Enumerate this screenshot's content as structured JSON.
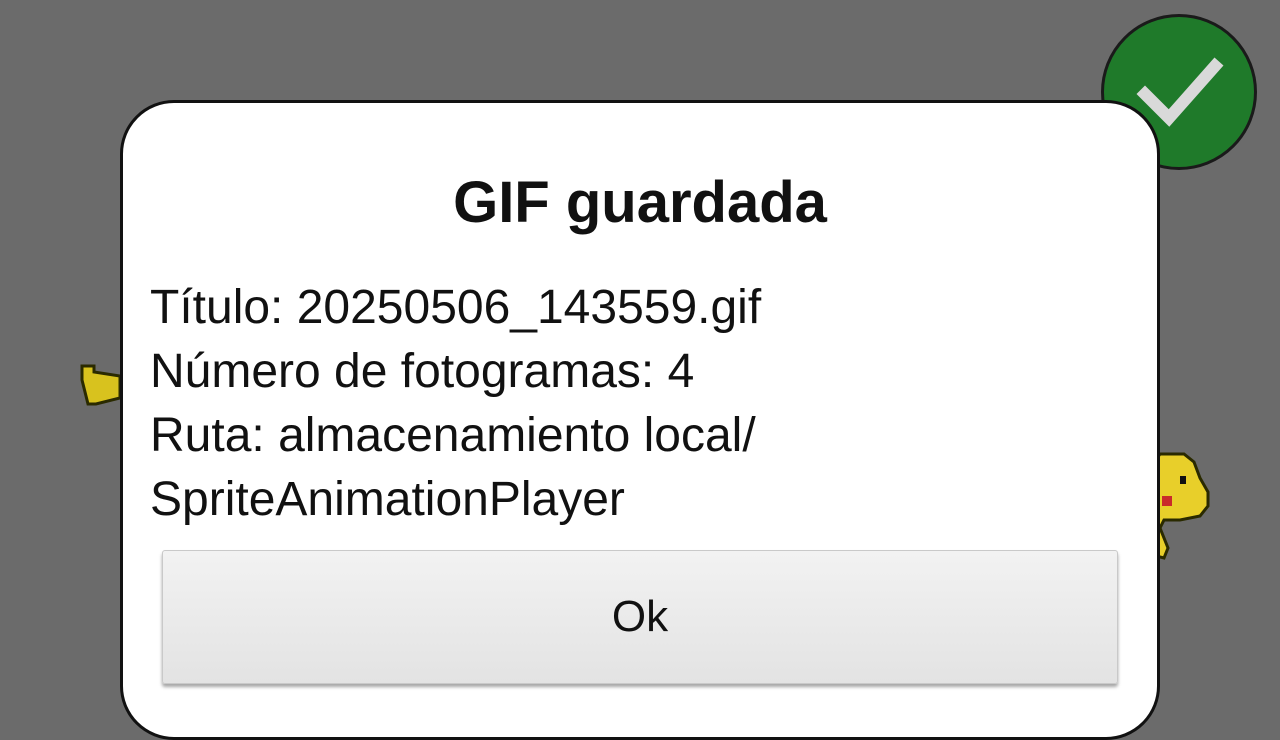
{
  "dialog": {
    "title": "GIF guardada",
    "lines": [
      "Título: 20250506_143559.gif",
      "Número de fotogramas: 4",
      "Ruta: almacenamiento local/",
      "SpriteAnimationPlayer"
    ],
    "ok_label": "Ok"
  },
  "background": {
    "confirm_icon": "checkmark-icon",
    "confirm_color": "#1f7a2a",
    "overlay_color": "#6b6b6b"
  }
}
